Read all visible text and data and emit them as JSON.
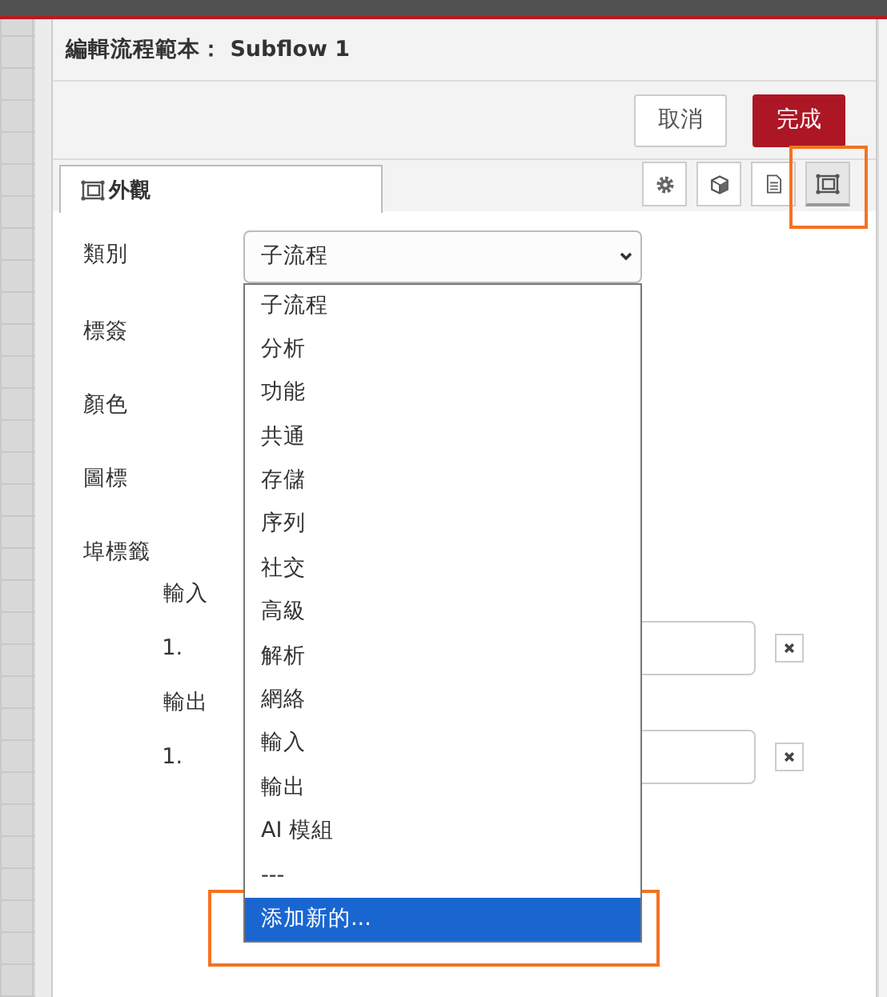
{
  "dialog": {
    "title": "編輯流程範本： Subflow 1",
    "buttons": [
      {
        "label": "取消",
        "kind": "secondary"
      },
      {
        "label": "完成",
        "kind": "primary"
      }
    ],
    "tabs": [
      {
        "label": "外觀",
        "selected": true
      }
    ],
    "tool_buttons": [
      {
        "kind": "settings",
        "selected": false
      },
      {
        "kind": "module",
        "selected": false
      },
      {
        "kind": "document",
        "selected": false
      },
      {
        "kind": "appearance",
        "selected": true
      }
    ],
    "form": {
      "category": {
        "label": "類別",
        "value": "子流程",
        "expanded": true,
        "options": [
          {
            "label": "子流程",
            "highlighted": false
          },
          {
            "label": "分析",
            "highlighted": false
          },
          {
            "label": "功能",
            "highlighted": false
          },
          {
            "label": "共通",
            "highlighted": false
          },
          {
            "label": "存儲",
            "highlighted": false
          },
          {
            "label": "序列",
            "highlighted": false
          },
          {
            "label": "社交",
            "highlighted": false
          },
          {
            "label": "高級",
            "highlighted": false
          },
          {
            "label": "解析",
            "highlighted": false
          },
          {
            "label": "網絡",
            "highlighted": false
          },
          {
            "label": "輸入",
            "highlighted": false
          },
          {
            "label": "輸出",
            "highlighted": false
          },
          {
            "label": "AI 模組",
            "highlighted": false
          },
          {
            "label": "---",
            "highlighted": false
          },
          {
            "label": "添加新的...",
            "highlighted": true
          }
        ]
      },
      "fields": [
        {
          "label": "標簽"
        },
        {
          "label": "顏色"
        },
        {
          "label": "圖標"
        }
      ],
      "ports": {
        "label": "埠標籤",
        "groups": [
          {
            "label": "輸入",
            "entries": [
              {
                "number": "1."
              }
            ]
          },
          {
            "label": "輸出",
            "entries": [
              {
                "number": "1."
              }
            ]
          }
        ]
      }
    }
  }
}
